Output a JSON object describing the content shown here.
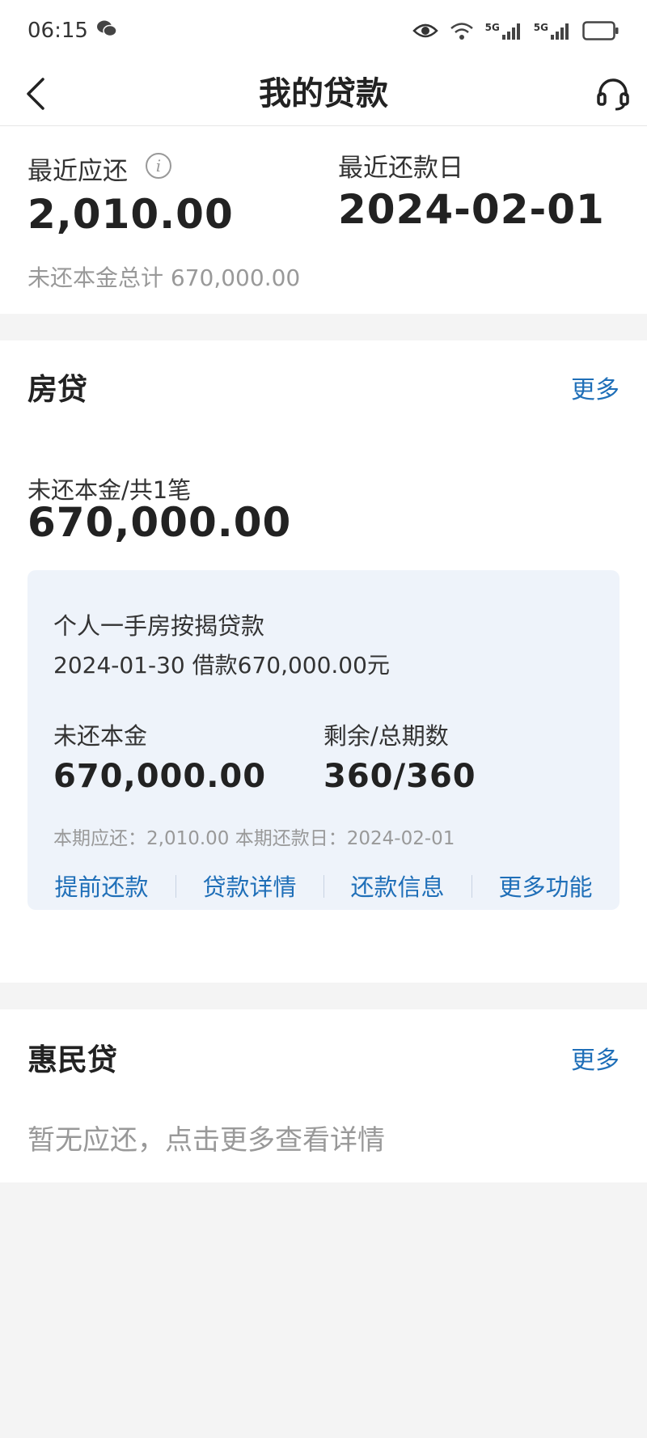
{
  "status_bar": {
    "time": "06:15",
    "signal1_label": "5G",
    "signal2_label": "5G"
  },
  "nav": {
    "title": "我的贷款"
  },
  "summary": {
    "recent_due_label": "最近应还",
    "recent_due_value": "2,010.00",
    "recent_date_label": "最近还款日",
    "recent_date_value": "2024-02-01",
    "total_unpaid_text": "未还本金总计 670,000.00"
  },
  "mortgage": {
    "title": "房贷",
    "more_label": "更多",
    "principal_label": "未还本金/共1笔",
    "principal_value": "670,000.00",
    "card": {
      "name": "个人一手房按揭贷款",
      "date_text": "2024-01-30 借款670,000.00元",
      "unpaid_label": "未还本金",
      "unpaid_value": "670,000.00",
      "periods_label": "剩余/总期数",
      "periods_value": "360/360",
      "period_text": "本期应还：2,010.00 本期还款日：2024-02-01",
      "actions": [
        "提前还款",
        "贷款详情",
        "还款信息",
        "更多功能"
      ]
    }
  },
  "huiminda": {
    "title": "惠民贷",
    "more_label": "更多",
    "empty_text": "暂无应还，点击更多查看详情"
  },
  "colors": {
    "accent": "#1f6fb8",
    "background": "#f4f4f4",
    "card_background": "#eef3fa"
  },
  "icons": [
    "back-arrow-icon",
    "headset-icon",
    "info-icon",
    "eye-icon",
    "wifi-icon",
    "signal-icon",
    "battery-icon",
    "wechat-icon"
  ]
}
